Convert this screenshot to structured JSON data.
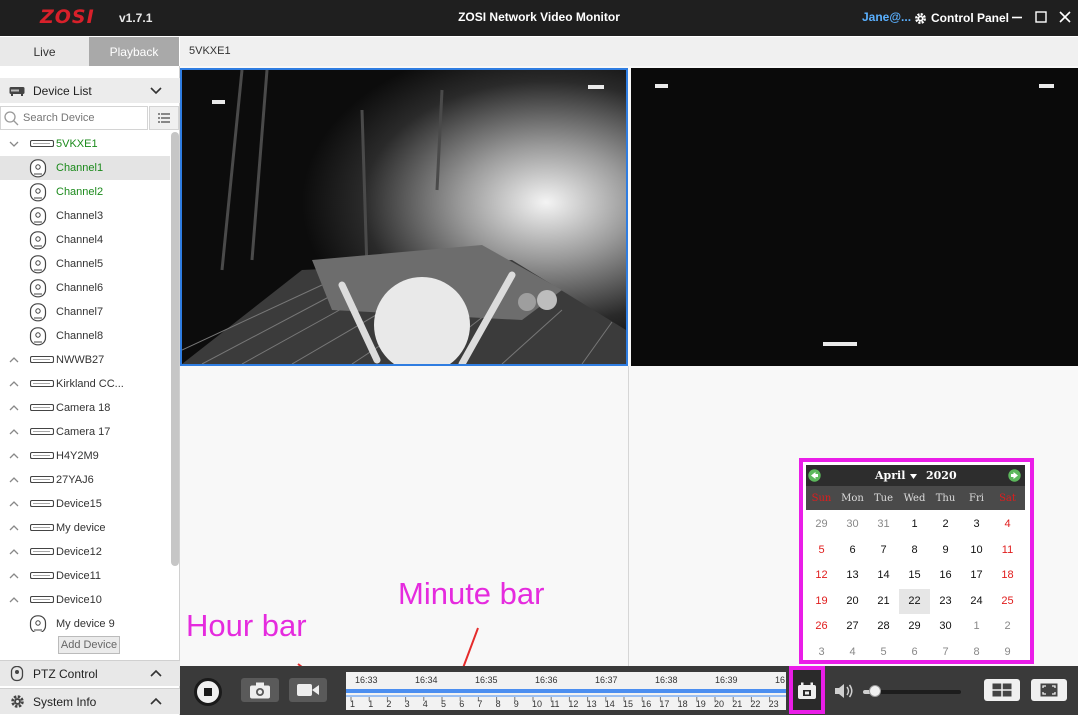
{
  "app": {
    "logo": "ZOSI",
    "version": "v1.7.1",
    "title": "ZOSI Network Video Monitor"
  },
  "user": {
    "name": "Jane@..."
  },
  "control_panel": {
    "label": "Control Panel"
  },
  "mode_tabs": [
    {
      "label": "Live",
      "active": false
    },
    {
      "label": "Playback",
      "active": true
    }
  ],
  "device_tab": {
    "label": "5VKXE1"
  },
  "sidebar": {
    "device_list_label": "Device List",
    "search_placeholder": "Search Device",
    "tree": [
      {
        "label": "5VKXE1",
        "type": "dvr",
        "expanded": true,
        "green": true
      },
      {
        "label": "Channel1",
        "type": "camera",
        "green": true,
        "selected": true
      },
      {
        "label": "Channel2",
        "type": "camera",
        "green": true
      },
      {
        "label": "Channel3",
        "type": "camera"
      },
      {
        "label": "Channel4",
        "type": "camera"
      },
      {
        "label": "Channel5",
        "type": "camera"
      },
      {
        "label": "Channel6",
        "type": "camera"
      },
      {
        "label": "Channel7",
        "type": "camera"
      },
      {
        "label": "Channel8",
        "type": "camera"
      },
      {
        "label": "NWWB27",
        "type": "dvr"
      },
      {
        "label": "Kirkland CC...",
        "type": "dvr"
      },
      {
        "label": "Camera 18",
        "type": "dvr"
      },
      {
        "label": "Camera 17",
        "type": "dvr"
      },
      {
        "label": "H4Y2M9",
        "type": "dvr"
      },
      {
        "label": "27YAJ6",
        "type": "dvr"
      },
      {
        "label": "Device15",
        "type": "dvr"
      },
      {
        "label": "My device",
        "type": "dvr"
      },
      {
        "label": "Device12",
        "type": "dvr"
      },
      {
        "label": "Device11",
        "type": "dvr"
      },
      {
        "label": "Device10",
        "type": "dvr"
      },
      {
        "label": "My device 9",
        "type": "camera"
      }
    ],
    "add_device_label": "Add Device",
    "ptz_label": "PTZ Control",
    "system_info_label": "System Info"
  },
  "calendar": {
    "month": "April",
    "year": "2020",
    "weekdays": [
      "Sun",
      "Mon",
      "Tue",
      "Wed",
      "Thu",
      "Fri",
      "Sat"
    ],
    "weeks": [
      [
        "29",
        "30",
        "31",
        "1",
        "2",
        "3",
        "4"
      ],
      [
        "5",
        "6",
        "7",
        "8",
        "9",
        "10",
        "11"
      ],
      [
        "12",
        "13",
        "14",
        "15",
        "16",
        "17",
        "18"
      ],
      [
        "19",
        "20",
        "21",
        "22",
        "23",
        "24",
        "25"
      ],
      [
        "26",
        "27",
        "28",
        "29",
        "30",
        "1",
        "2"
      ],
      [
        "3",
        "4",
        "5",
        "6",
        "7",
        "8",
        "9"
      ]
    ],
    "selected_day": "22"
  },
  "annotations": {
    "hour_bar": "Hour bar",
    "minute_bar": "Minute bar"
  },
  "timeline": {
    "minute_labels": [
      "16:33",
      "16:34",
      "16:35",
      "16:36",
      "16:37",
      "16:38",
      "16:39",
      "16"
    ],
    "hour_labels": [
      "1",
      "1",
      "2",
      "3",
      "4",
      "5",
      "6",
      "7",
      "8",
      "9",
      "10",
      "11",
      "12",
      "13",
      "14",
      "15",
      "16",
      "17",
      "18",
      "19",
      "20",
      "21",
      "22",
      "23"
    ]
  },
  "volume": {
    "level": 0.12
  },
  "colors": {
    "accent": "#2f7de1",
    "highlight": "#ea1de8",
    "brand": "#d8202a",
    "green": "#1b8a1b"
  }
}
